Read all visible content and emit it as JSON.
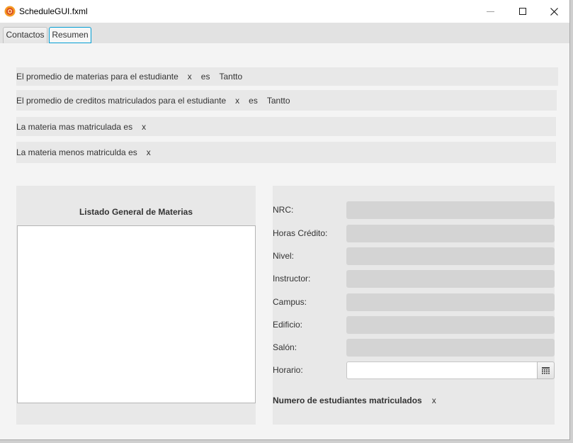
{
  "window": {
    "title": "ScheduleGUI.fxml",
    "icons": {
      "app": "app-icon",
      "minimize": "minimize-icon",
      "maximize": "maximize-icon",
      "close": "close-icon"
    }
  },
  "tabs": [
    {
      "label": "Contactos",
      "selected": false
    },
    {
      "label": "Resumen",
      "selected": true
    }
  ],
  "summary_rows": [
    {
      "label": "El promedio de materias para el estudiante",
      "value": "x",
      "connector": "es",
      "result": "Tantto"
    },
    {
      "label": "El promedio de creditos matriculados para el estudiante",
      "value": "x",
      "connector": "es",
      "result": "Tantto"
    },
    {
      "label": "La materia mas matriculada es",
      "value": "x"
    },
    {
      "label": "La materia menos matriculda es",
      "value": "x"
    }
  ],
  "materias": {
    "title": "Listado General de Materias",
    "items": []
  },
  "details": {
    "fields": [
      {
        "label": "NRC:",
        "value": ""
      },
      {
        "label": "Horas Crédito:",
        "value": ""
      },
      {
        "label": "Nivel:",
        "value": ""
      },
      {
        "label": "Instructor:",
        "value": ""
      },
      {
        "label": "Campus:",
        "value": ""
      },
      {
        "label": "Edificio:",
        "value": ""
      },
      {
        "label": "Salón:",
        "value": ""
      }
    ],
    "horario": {
      "label": "Horario:",
      "value": "",
      "icon": "calendar-icon"
    },
    "estudiantes": {
      "label": "Numero de estudiantes matriculados",
      "value": "x"
    }
  },
  "colors": {
    "accent": "#039ed3",
    "title_bar": "#ffffff",
    "content_bg": "#f4f4f4",
    "panel_bg": "#e8e8e8",
    "field_bg": "#d4d4d4",
    "list_bg": "#ffffff",
    "app_icon": "#f59b23"
  }
}
